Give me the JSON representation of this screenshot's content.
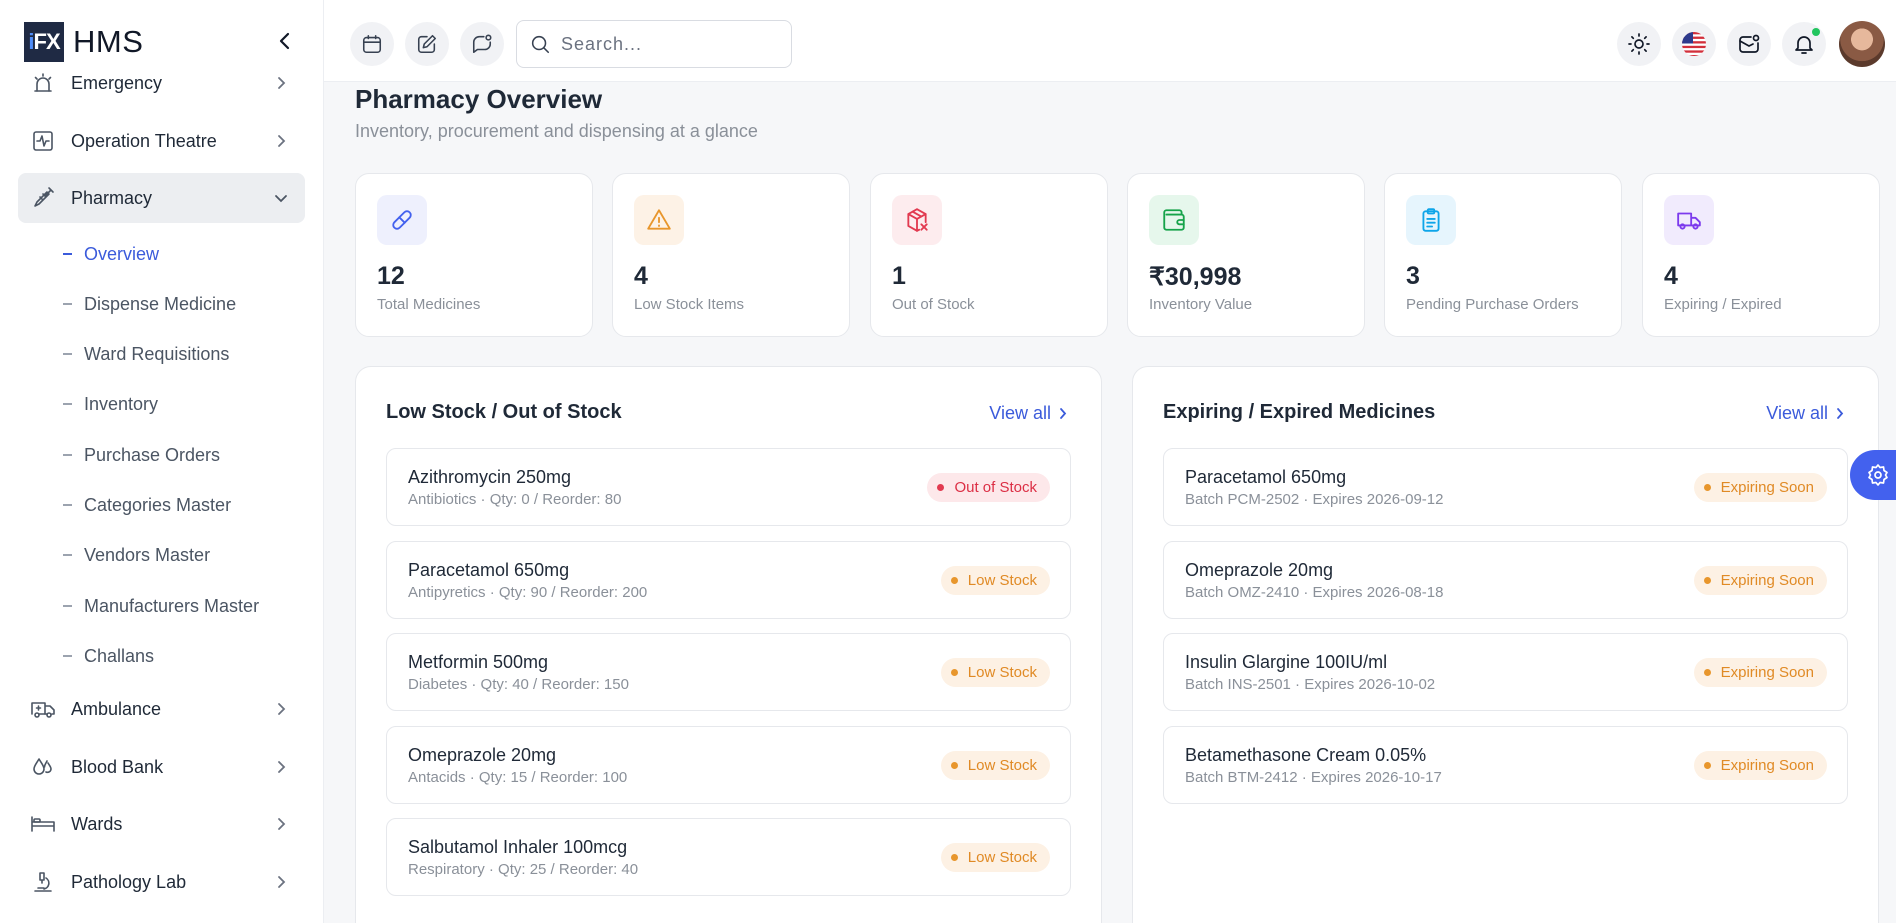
{
  "brand": {
    "logo_text": "iFX",
    "name": "HMS"
  },
  "sidebar": {
    "items": [
      {
        "label": "Emergency",
        "icon": "emergency-icon"
      },
      {
        "label": "Operation Theatre",
        "icon": "activity-icon"
      },
      {
        "label": "Pharmacy",
        "icon": "syringe-icon"
      },
      {
        "label": "Ambulance",
        "icon": "ambulance-icon"
      },
      {
        "label": "Blood Bank",
        "icon": "droplets-icon"
      },
      {
        "label": "Wards",
        "icon": "bed-icon"
      },
      {
        "label": "Pathology Lab",
        "icon": "microscope-icon"
      }
    ],
    "pharmacy_sub": [
      {
        "label": "Overview"
      },
      {
        "label": "Dispense Medicine"
      },
      {
        "label": "Ward Requisitions"
      },
      {
        "label": "Inventory"
      },
      {
        "label": "Purchase Orders"
      },
      {
        "label": "Categories Master"
      },
      {
        "label": "Vendors Master"
      },
      {
        "label": "Manufacturers Master"
      },
      {
        "label": "Challans"
      }
    ]
  },
  "topbar": {
    "search_placeholder": "Search..."
  },
  "page": {
    "title": "Pharmacy Overview",
    "subtitle": "Inventory, procurement and dispensing at a glance"
  },
  "stats": [
    {
      "value": "12",
      "label": "Total Medicines",
      "icon": "pill-icon",
      "color": "#4361ee",
      "bg": "#eef0fd"
    },
    {
      "value": "4",
      "label": "Low Stock Items",
      "icon": "warning-icon",
      "color": "#e8962c",
      "bg": "#fdf2e6"
    },
    {
      "value": "1",
      "label": "Out of Stock",
      "icon": "package-x-icon",
      "color": "#e23a50",
      "bg": "#fdecee"
    },
    {
      "value": "₹30,998",
      "label": "Inventory Value",
      "icon": "wallet-icon",
      "color": "#16a34a",
      "bg": "#e6f7ec"
    },
    {
      "value": "3",
      "label": "Pending Purchase Orders",
      "icon": "clipboard-icon",
      "color": "#0ea5e9",
      "bg": "#e6f5fd"
    },
    {
      "value": "4",
      "label": "Expiring / Expired",
      "icon": "truck-icon",
      "color": "#7c3aed",
      "bg": "#f1ebfd"
    }
  ],
  "low_stock": {
    "title": "Low Stock / Out of Stock",
    "view_all": "View all",
    "rows": [
      {
        "name": "Azithromycin 250mg",
        "meta": "Antibiotics · Qty: 0 / Reorder: 80",
        "badge": "Out of Stock"
      },
      {
        "name": "Paracetamol 650mg",
        "meta": "Antipyretics · Qty: 90 / Reorder: 200",
        "badge": "Low Stock"
      },
      {
        "name": "Metformin 500mg",
        "meta": "Diabetes · Qty: 40 / Reorder: 150",
        "badge": "Low Stock"
      },
      {
        "name": "Omeprazole 20mg",
        "meta": "Antacids · Qty: 15 / Reorder: 100",
        "badge": "Low Stock"
      },
      {
        "name": "Salbutamol Inhaler 100mcg",
        "meta": "Respiratory · Qty: 25 / Reorder: 40",
        "badge": "Low Stock"
      }
    ]
  },
  "expiring": {
    "title": "Expiring / Expired Medicines",
    "view_all": "View all",
    "rows": [
      {
        "name": "Paracetamol 650mg",
        "meta": "Batch PCM-2502 · Expires 2026-09-12",
        "badge": "Expiring Soon"
      },
      {
        "name": "Omeprazole 20mg",
        "meta": "Batch OMZ-2410 · Expires 2026-08-18",
        "badge": "Expiring Soon"
      },
      {
        "name": "Insulin Glargine 100IU/ml",
        "meta": "Batch INS-2501 · Expires 2026-10-02",
        "badge": "Expiring Soon"
      },
      {
        "name": "Betamethasone Cream 0.05%",
        "meta": "Batch BTM-2412 · Expires 2026-10-17",
        "badge": "Expiring Soon"
      }
    ]
  }
}
